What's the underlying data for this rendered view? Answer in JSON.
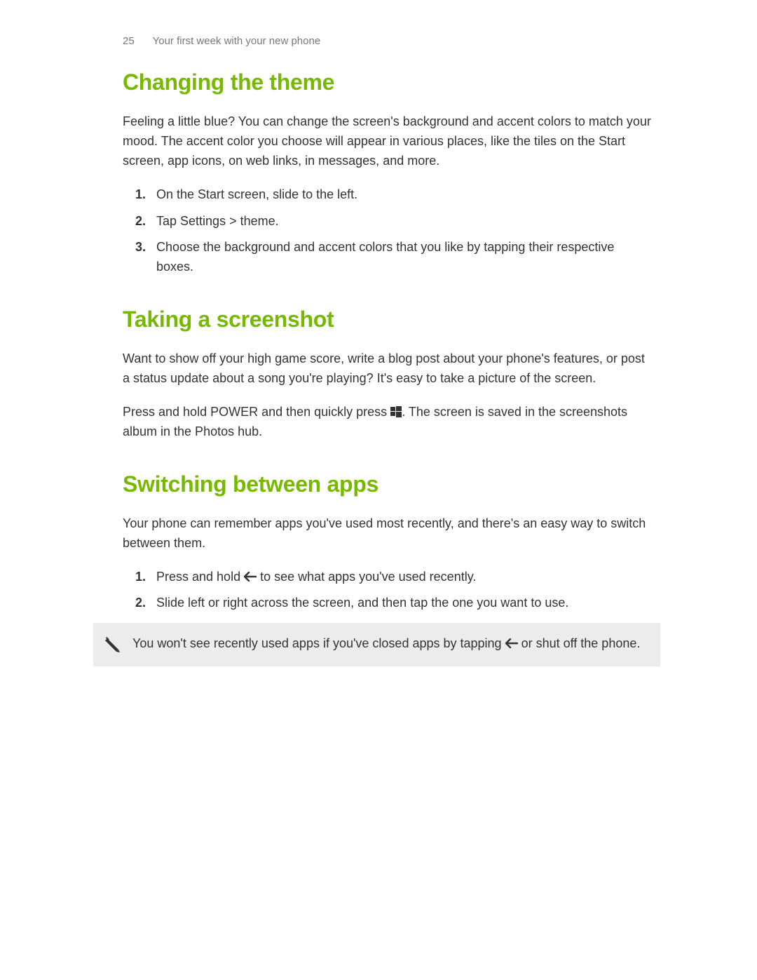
{
  "header": {
    "page_number": "25",
    "chapter": "Your first week with your new phone"
  },
  "sections": {
    "s1": {
      "title": "Changing the theme",
      "intro": "Feeling a little blue? You can change the screen's background and accent colors to match your mood. The accent color you choose will appear in various places, like the tiles on the Start screen, app icons, on web links, in messages, and more.",
      "steps": {
        "step1": "On the Start screen, slide to the left.",
        "step2_prefix": "Tap ",
        "step2_settings": "Settings",
        "step2_gt": " > ",
        "step2_theme": "theme",
        "step2_suffix": ".",
        "step3": "Choose the background and accent colors that you like by tapping their respective boxes."
      }
    },
    "s2": {
      "title": "Taking a screenshot",
      "intro": "Want to show off your high game score, write a blog post about your phone's features, or post a status update about a song you're playing? It's easy to take a picture of the screen.",
      "body_prefix": "Press and hold POWER and then quickly press ",
      "body_mid": ". The screen is saved in the ",
      "body_album": "screenshots",
      "body_suffix": " album in the Photos hub."
    },
    "s3": {
      "title": "Switching between apps",
      "intro": "Your phone can remember apps you've used most recently, and there's an easy way to switch between them.",
      "steps": {
        "step1_prefix": "Press and hold ",
        "step1_suffix": " to see what apps you've used recently.",
        "step2": "Slide left or right across the screen, and then tap the one you want to use."
      },
      "note_prefix": "You won't see recently used apps if you've closed apps by tapping ",
      "note_suffix": " or shut off the phone."
    }
  }
}
